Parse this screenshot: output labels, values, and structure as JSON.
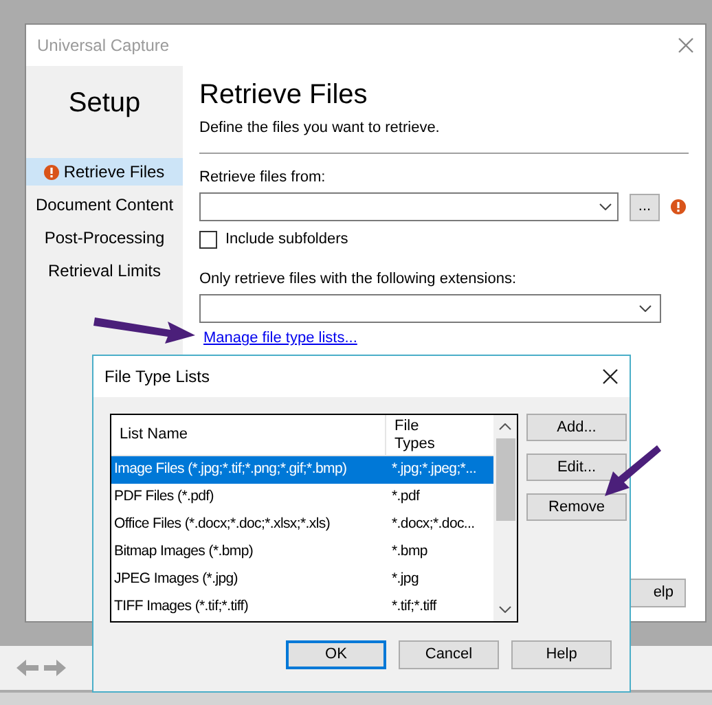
{
  "window": {
    "title": "Universal Capture"
  },
  "sidebar": {
    "heading": "Setup",
    "items": [
      {
        "label": "Retrieve Files",
        "selected": true,
        "warning": true
      },
      {
        "label": "Document Content",
        "selected": false,
        "warning": false
      },
      {
        "label": "Post-Processing",
        "selected": false,
        "warning": false
      },
      {
        "label": "Retrieval Limits",
        "selected": false,
        "warning": false
      }
    ]
  },
  "page": {
    "title": "Retrieve Files",
    "subtitle": "Define the files you want to retrieve.",
    "source_label": "Retrieve files from:",
    "browse_button": "...",
    "source_warning": true,
    "subfolders": {
      "label": "Include subfolders",
      "checked": false
    },
    "extensions_label": "Only retrieve files with the following extensions:",
    "manage_link": "Manage file type lists...",
    "help_button": "elp"
  },
  "dialog": {
    "title": "File Type Lists",
    "columns": [
      "List Name",
      "File Types"
    ],
    "rows": [
      {
        "name": "Image Files (*.jpg;*.tif;*.png;*.gif;*.bmp)",
        "types": "*.jpg;*.jpeg;*...",
        "selected": true
      },
      {
        "name": "PDF Files (*.pdf)",
        "types": "*.pdf",
        "selected": false
      },
      {
        "name": "Office Files (*.docx;*.doc;*.xlsx;*.xls)",
        "types": "*.docx;*.doc...",
        "selected": false
      },
      {
        "name": "Bitmap Images (*.bmp)",
        "types": "*.bmp",
        "selected": false
      },
      {
        "name": "JPEG Images (*.jpg)",
        "types": "*.jpg",
        "selected": false
      },
      {
        "name": "TIFF Images (*.tif;*.tiff)",
        "types": "*.tif;*.tiff",
        "selected": false
      }
    ],
    "side_buttons": [
      "Add...",
      "Edit...",
      "Remove"
    ],
    "footer_buttons": [
      {
        "label": "OK",
        "default": true
      },
      {
        "label": "Cancel",
        "default": false
      },
      {
        "label": "Help",
        "default": false
      }
    ]
  }
}
